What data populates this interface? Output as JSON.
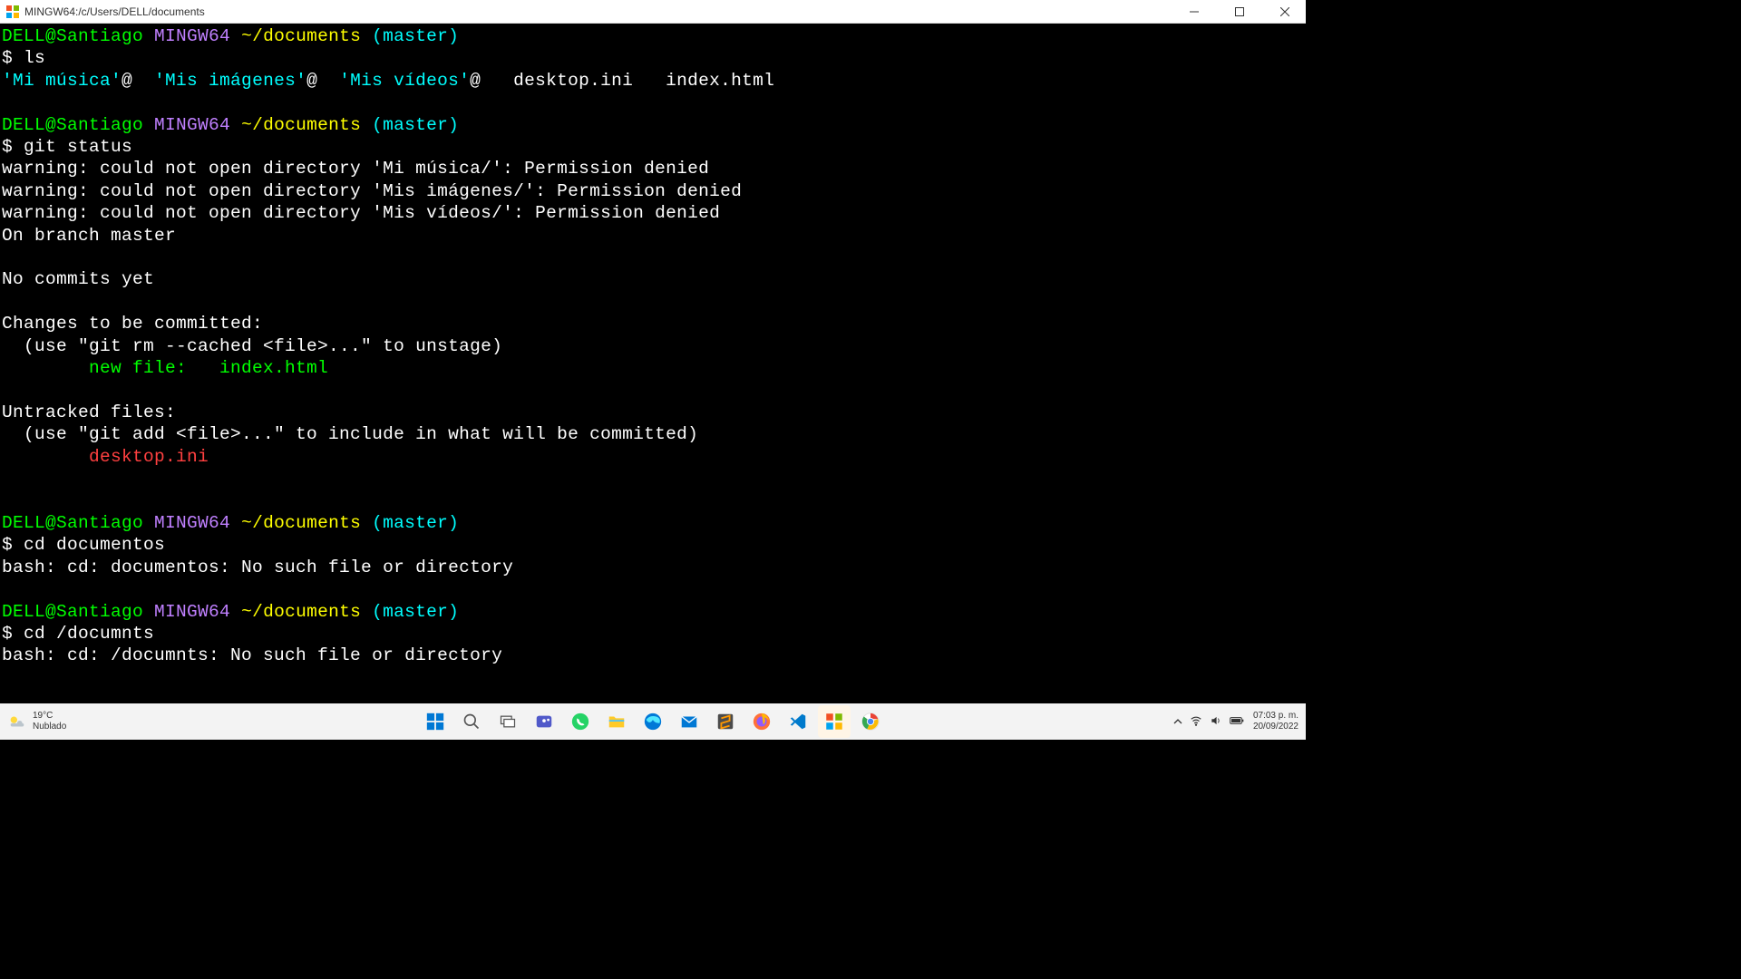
{
  "titlebar": {
    "title": "MINGW64:/c/Users/DELL/documents"
  },
  "prompt": {
    "user": "DELL@Santiago",
    "env": "MINGW64",
    "path": "~/documents",
    "branch": "(master)"
  },
  "terminal": {
    "cmd1": "$ ls",
    "ls_out1": "'Mi música'",
    "ls_out1s": "@  ",
    "ls_out2": "'Mis imágenes'",
    "ls_out2s": "@  ",
    "ls_out3": "'Mis vídeos'",
    "ls_out3s": "@   desktop.ini   index.html",
    "cmd2": "$ git status",
    "warn1": "warning: could not open directory 'Mi música/': Permission denied",
    "warn2": "warning: could not open directory 'Mis imágenes/': Permission denied",
    "warn3": "warning: could not open directory 'Mis vídeos/': Permission denied",
    "branch": "On branch master",
    "nocommits": "No commits yet",
    "changes_hdr": "Changes to be committed:",
    "unstage": "  (use \"git rm --cached <file>...\" to unstage)",
    "newfile": "        new file:   index.html",
    "untracked_hdr": "Untracked files:",
    "untracked_hint": "  (use \"git add <file>...\" to include in what will be committed)",
    "untracked_file": "        desktop.ini",
    "cmd3": "$ cd documentos",
    "err3": "bash: cd: documentos: No such file or directory",
    "cmd4": "$ cd /documnts",
    "err4": "bash: cd: /documnts: No such file or directory"
  },
  "taskbar": {
    "weather_temp": "19°C",
    "weather_desc": "Nublado",
    "time": "07:03 p. m.",
    "date": "20/09/2022"
  }
}
